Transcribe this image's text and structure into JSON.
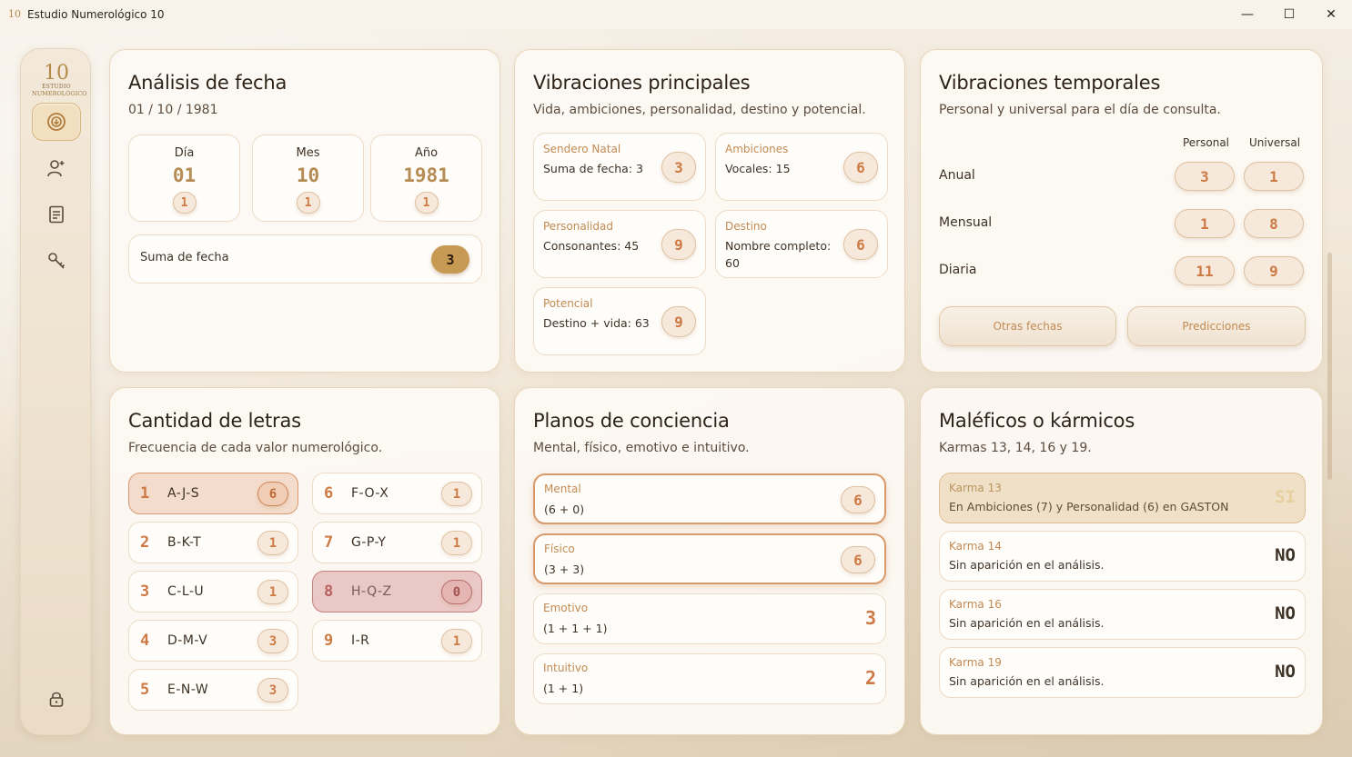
{
  "window": {
    "app_icon_text": "10",
    "title": "Estudio Numerológico 10",
    "minimize": "—",
    "maximize": "☐",
    "close": "✕"
  },
  "sidebar": {
    "logo_main": "10",
    "logo_small": "ESTUDIO",
    "logo_sub": "NUMEROLÓGICO",
    "items": [
      "home",
      "person",
      "document",
      "key"
    ],
    "lock": "lock"
  },
  "fecha": {
    "title": "Análisis de fecha",
    "subtitle": "01 / 10 / 1981",
    "boxes": [
      {
        "label": "Día",
        "value": "01",
        "reduced": "1"
      },
      {
        "label": "Mes",
        "value": "10",
        "reduced": "1"
      },
      {
        "label": "Año",
        "value": "1981",
        "reduced": "1"
      }
    ],
    "sum_label": "Suma de fecha",
    "sum_value": "3"
  },
  "vibraciones": {
    "title": "Vibraciones principales",
    "subtitle": "Vida, ambiciones, personalidad, destino y potencial.",
    "items": [
      {
        "title": "Sendero Natal",
        "desc": "Suma de fecha: 3",
        "value": "3"
      },
      {
        "title": "Ambiciones",
        "desc": "Vocales: 15",
        "value": "6"
      },
      {
        "title": "Personalidad",
        "desc": "Consonantes: 45",
        "value": "9"
      },
      {
        "title": "Destino",
        "desc": "Nombre completo: 60",
        "value": "6"
      },
      {
        "title": "Potencial",
        "desc": "Destino + vida: 63",
        "value": "9"
      }
    ]
  },
  "temporales": {
    "title": "Vibraciones temporales",
    "subtitle": "Personal y universal para el día de consulta.",
    "col_personal": "Personal",
    "col_universal": "Universal",
    "rows": [
      {
        "label": "Anual",
        "personal": "3",
        "universal": "1"
      },
      {
        "label": "Mensual",
        "personal": "1",
        "universal": "8"
      },
      {
        "label": "Diaria",
        "personal": "11",
        "universal": "9"
      }
    ],
    "btn_otras": "Otras fechas",
    "btn_predicciones": "Predicciones"
  },
  "letras": {
    "title": "Cantidad de letras",
    "subtitle": "Frecuencia de cada valor numerológico.",
    "items": [
      {
        "num": "1",
        "letters": "A-J-S",
        "count": "6",
        "hl": "orange"
      },
      {
        "num": "2",
        "letters": "B-K-T",
        "count": "1",
        "hl": ""
      },
      {
        "num": "3",
        "letters": "C-L-U",
        "count": "1",
        "hl": ""
      },
      {
        "num": "4",
        "letters": "D-M-V",
        "count": "3",
        "hl": ""
      },
      {
        "num": "5",
        "letters": "E-N-W",
        "count": "3",
        "hl": ""
      },
      {
        "num": "6",
        "letters": "F-O-X",
        "count": "1",
        "hl": ""
      },
      {
        "num": "7",
        "letters": "G-P-Y",
        "count": "1",
        "hl": ""
      },
      {
        "num": "8",
        "letters": "H-Q-Z",
        "count": "0",
        "hl": "red"
      },
      {
        "num": "9",
        "letters": "I-R",
        "count": "1",
        "hl": ""
      }
    ]
  },
  "planos": {
    "title": "Planos de conciencia",
    "subtitle": "Mental, físico, emotivo e intuitivo.",
    "items": [
      {
        "title": "Mental",
        "formula": "(6 + 0)",
        "value": "6"
      },
      {
        "title": "Físico",
        "formula": "(3 + 3)",
        "value": "6"
      },
      {
        "title": "Emotivo",
        "formula": "(1 + 1 + 1)",
        "value": "3"
      },
      {
        "title": "Intuitivo",
        "formula": "(1 + 1)",
        "value": "2"
      }
    ]
  },
  "karmas": {
    "title": "Maléficos o kármicos",
    "subtitle": "Karmas 13, 14, 16 y 19.",
    "items": [
      {
        "title": "Karma 13",
        "desc": "En Ambiciones (7) y Personalidad (6) en GASTON",
        "value": "SI"
      },
      {
        "title": "Karma 14",
        "desc": "Sin aparición en el análisis.",
        "value": "NO"
      },
      {
        "title": "Karma 16",
        "desc": "Sin aparición en el análisis.",
        "value": "NO"
      },
      {
        "title": "Karma 19",
        "desc": "Sin aparición en el análisis.",
        "value": "NO"
      }
    ]
  }
}
